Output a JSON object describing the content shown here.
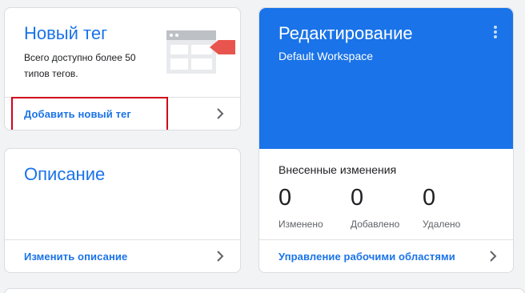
{
  "new_tag_card": {
    "title": "Новый тег",
    "description": "Всего доступно более 50 типов тегов.",
    "link_label": "Добавить новый тег",
    "highlight_color": "#d0021b"
  },
  "description_card": {
    "title": "Описание",
    "link_label": "Изменить описание"
  },
  "workspace_card": {
    "title": "Редактирование",
    "subtitle": "Default Workspace",
    "menu_icon": "more-vert-icon",
    "changes_label": "Внесенные изменения",
    "stats": [
      {
        "value": "0",
        "label": "Изменено"
      },
      {
        "value": "0",
        "label": "Добавлено"
      },
      {
        "value": "0",
        "label": "Удалено"
      }
    ],
    "link_label": "Управление рабочими областями",
    "header_color": "#1a73e8"
  },
  "icons": {
    "chevron": "chevron-right-icon",
    "illustration": "tag-illustration-icon"
  },
  "colors": {
    "accent": "#1a73e8",
    "background": "#f1f3f4",
    "tag_red": "#e8554e"
  }
}
